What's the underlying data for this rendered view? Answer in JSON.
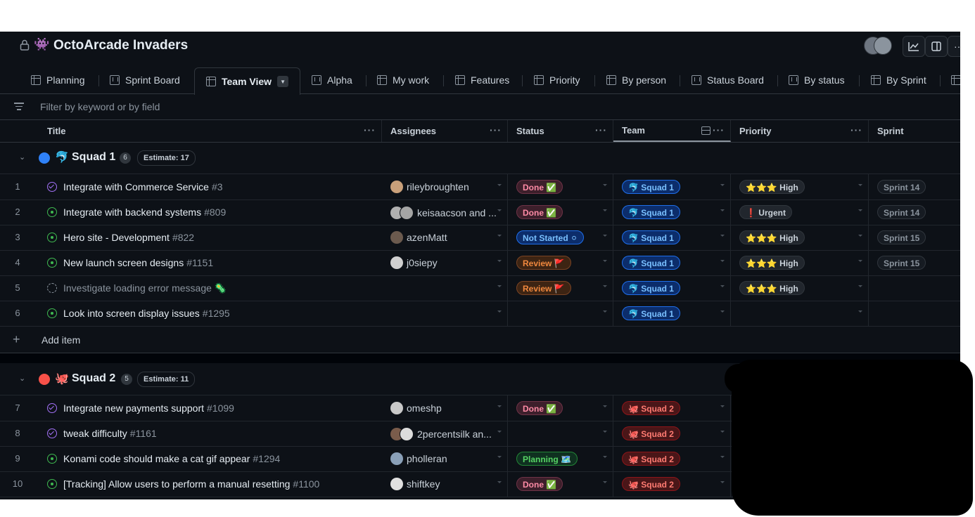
{
  "header": {
    "project_emoji": "👾",
    "project_title": "OctoArcade Invaders",
    "actions": [
      "insights-icon",
      "sidepanel-icon",
      "more-icon"
    ]
  },
  "tabs": [
    {
      "label": "Planning",
      "type": "table"
    },
    {
      "label": "Sprint Board",
      "type": "board"
    },
    {
      "label": "Team View",
      "type": "table",
      "active": true
    },
    {
      "label": "Alpha",
      "type": "board"
    },
    {
      "label": "My work",
      "type": "table"
    },
    {
      "label": "Features",
      "type": "table"
    },
    {
      "label": "Priority",
      "type": "table"
    },
    {
      "label": "By person",
      "type": "table"
    },
    {
      "label": "Status Board",
      "type": "board"
    },
    {
      "label": "By status",
      "type": "board"
    },
    {
      "label": "By Sprint",
      "type": "table"
    }
  ],
  "filter": {
    "placeholder": "Filter by keyword or by field"
  },
  "columns": [
    "Title",
    "Assignees",
    "Status",
    "Team",
    "Priority",
    "Sprint"
  ],
  "groups": [
    {
      "emoji": "🐬",
      "name": "Squad 1",
      "count": "6",
      "estimate": "Estimate: 17",
      "color": "#2f81f7",
      "rows": [
        {
          "n": "1",
          "state": "closed",
          "title": "Integrate with Commerce Service",
          "num": "#3",
          "assignee": "rileybroughten",
          "status": "Done ✅",
          "team": "🐬 Squad 1",
          "priority": "⭐⭐⭐ High",
          "sprint": "Sprint 14"
        },
        {
          "n": "2",
          "state": "open",
          "title": "Integrate with backend systems",
          "num": "#809",
          "assignee": "keisaacson and ...",
          "status": "Done ✅",
          "team": "🐬 Squad 1",
          "priority": "❗ Urgent",
          "sprint": "Sprint 14"
        },
        {
          "n": "3",
          "state": "open",
          "title": "Hero site - Development",
          "num": "#822",
          "assignee": "azenMatt",
          "status": "Not Started ⚪",
          "team": "🐬 Squad 1",
          "priority": "⭐⭐⭐ High",
          "sprint": "Sprint 15"
        },
        {
          "n": "4",
          "state": "open",
          "title": "New launch screen designs",
          "num": "#1151",
          "assignee": "j0siepy",
          "status": "Review 🚩",
          "team": "🐬 Squad 1",
          "priority": "⭐⭐⭐ High",
          "sprint": "Sprint 15"
        },
        {
          "n": "5",
          "state": "draft",
          "title": "Investigate loading error message 🦠",
          "num": "",
          "assignee": "",
          "status": "Review 🚩",
          "team": "🐬 Squad 1",
          "priority": "⭐⭐⭐ High",
          "sprint": ""
        },
        {
          "n": "6",
          "state": "open",
          "title": "Look into screen display issues",
          "num": "#1295",
          "assignee": "",
          "status": "",
          "team": "🐬 Squad 1",
          "priority": "",
          "sprint": ""
        }
      ],
      "add_item": "Add item"
    },
    {
      "emoji": "🐙",
      "name": "Squad 2",
      "count": "5",
      "estimate": "Estimate: 11",
      "color": "#f85149",
      "rows": [
        {
          "n": "7",
          "state": "closed",
          "title": "Integrate new payments support",
          "num": "#1099",
          "assignee": "omeshp",
          "status": "Done ✅",
          "team": "🐙 Squad 2"
        },
        {
          "n": "8",
          "state": "closed",
          "title": "tweak difficulty",
          "num": "#1161",
          "assignee": "2percentsilk an...",
          "status": "",
          "team": "🐙 Squad 2"
        },
        {
          "n": "9",
          "state": "open",
          "title": "Konami code should make a cat gif appear",
          "num": "#1294",
          "assignee": "pholleran",
          "status": "Planning 🗺️",
          "team": "🐙 Squad 2"
        },
        {
          "n": "10",
          "state": "open",
          "title": "[Tracking] Allow users to perform a manual resetting",
          "num": "#1100",
          "assignee": "shiftkey",
          "status": "Done ✅",
          "team": "🐙 Squad 2"
        }
      ]
    }
  ]
}
